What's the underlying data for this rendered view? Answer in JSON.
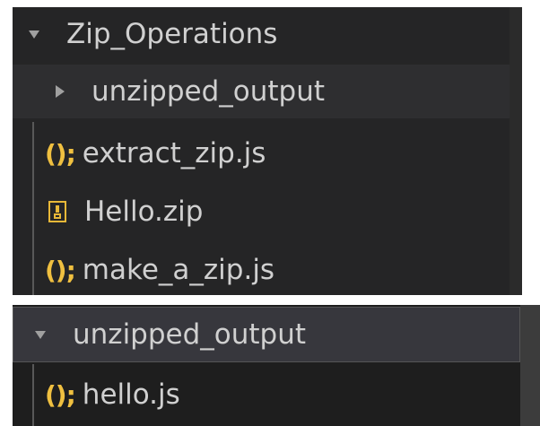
{
  "explorer_top": {
    "root_folder": {
      "label": "Zip_Operations",
      "expanded": true,
      "chevron_icon": "chevron-down-icon"
    },
    "subfolder": {
      "label": "unzipped_output",
      "expanded": false,
      "chevron_icon": "chevron-right-icon"
    },
    "files": [
      {
        "icon": "()",
        "icon_suffix": ";",
        "icon_name": "js-file-icon",
        "label": "extract_zip.js"
      },
      {
        "icon": "",
        "icon_name": "zip-file-icon",
        "label": "Hello.zip"
      },
      {
        "icon": "()",
        "icon_suffix": ";",
        "icon_name": "js-file-icon",
        "label": "make_a_zip.js"
      }
    ]
  },
  "explorer_bottom": {
    "folder": {
      "label": "unzipped_output",
      "expanded": true,
      "chevron_icon": "chevron-down-icon"
    },
    "files": [
      {
        "icon": "()",
        "icon_suffix": ";",
        "icon_name": "js-file-icon",
        "label": "hello.js"
      }
    ]
  },
  "colors": {
    "panel_bg": "#252526",
    "text": "#d0d0d0",
    "js_icon": "#f0c040",
    "zip_icon": "#e8b838",
    "selected_row_bg": "#37373d"
  }
}
